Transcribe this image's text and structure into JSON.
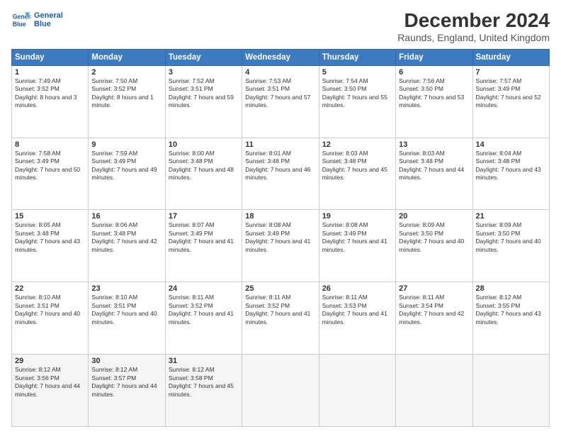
{
  "logo": {
    "line1": "General",
    "line2": "Blue"
  },
  "title": "December 2024",
  "subtitle": "Raunds, England, United Kingdom",
  "headers": [
    "Sunday",
    "Monday",
    "Tuesday",
    "Wednesday",
    "Thursday",
    "Friday",
    "Saturday"
  ],
  "weeks": [
    [
      {
        "day": "1",
        "sunrise": "7:49 AM",
        "sunset": "3:52 PM",
        "daylight": "8 hours and 3 minutes."
      },
      {
        "day": "2",
        "sunrise": "7:50 AM",
        "sunset": "3:52 PM",
        "daylight": "8 hours and 1 minute."
      },
      {
        "day": "3",
        "sunrise": "7:52 AM",
        "sunset": "3:51 PM",
        "daylight": "7 hours and 59 minutes."
      },
      {
        "day": "4",
        "sunrise": "7:53 AM",
        "sunset": "3:51 PM",
        "daylight": "7 hours and 57 minutes."
      },
      {
        "day": "5",
        "sunrise": "7:54 AM",
        "sunset": "3:50 PM",
        "daylight": "7 hours and 55 minutes."
      },
      {
        "day": "6",
        "sunrise": "7:56 AM",
        "sunset": "3:50 PM",
        "daylight": "7 hours and 53 minutes."
      },
      {
        "day": "7",
        "sunrise": "7:57 AM",
        "sunset": "3:49 PM",
        "daylight": "7 hours and 52 minutes."
      }
    ],
    [
      {
        "day": "8",
        "sunrise": "7:58 AM",
        "sunset": "3:49 PM",
        "daylight": "7 hours and 50 minutes."
      },
      {
        "day": "9",
        "sunrise": "7:59 AM",
        "sunset": "3:49 PM",
        "daylight": "7 hours and 49 minutes."
      },
      {
        "day": "10",
        "sunrise": "8:00 AM",
        "sunset": "3:48 PM",
        "daylight": "7 hours and 48 minutes."
      },
      {
        "day": "11",
        "sunrise": "8:01 AM",
        "sunset": "3:48 PM",
        "daylight": "7 hours and 46 minutes."
      },
      {
        "day": "12",
        "sunrise": "8:03 AM",
        "sunset": "3:48 PM",
        "daylight": "7 hours and 45 minutes."
      },
      {
        "day": "13",
        "sunrise": "8:03 AM",
        "sunset": "3:48 PM",
        "daylight": "7 hours and 44 minutes."
      },
      {
        "day": "14",
        "sunrise": "8:04 AM",
        "sunset": "3:48 PM",
        "daylight": "7 hours and 43 minutes."
      }
    ],
    [
      {
        "day": "15",
        "sunrise": "8:05 AM",
        "sunset": "3:48 PM",
        "daylight": "7 hours and 43 minutes."
      },
      {
        "day": "16",
        "sunrise": "8:06 AM",
        "sunset": "3:48 PM",
        "daylight": "7 hours and 42 minutes."
      },
      {
        "day": "17",
        "sunrise": "8:07 AM",
        "sunset": "3:49 PM",
        "daylight": "7 hours and 41 minutes."
      },
      {
        "day": "18",
        "sunrise": "8:08 AM",
        "sunset": "3:49 PM",
        "daylight": "7 hours and 41 minutes."
      },
      {
        "day": "19",
        "sunrise": "8:08 AM",
        "sunset": "3:49 PM",
        "daylight": "7 hours and 41 minutes."
      },
      {
        "day": "20",
        "sunrise": "8:09 AM",
        "sunset": "3:50 PM",
        "daylight": "7 hours and 40 minutes."
      },
      {
        "day": "21",
        "sunrise": "8:09 AM",
        "sunset": "3:50 PM",
        "daylight": "7 hours and 40 minutes."
      }
    ],
    [
      {
        "day": "22",
        "sunrise": "8:10 AM",
        "sunset": "3:51 PM",
        "daylight": "7 hours and 40 minutes."
      },
      {
        "day": "23",
        "sunrise": "8:10 AM",
        "sunset": "3:51 PM",
        "daylight": "7 hours and 40 minutes."
      },
      {
        "day": "24",
        "sunrise": "8:11 AM",
        "sunset": "3:52 PM",
        "daylight": "7 hours and 41 minutes."
      },
      {
        "day": "25",
        "sunrise": "8:11 AM",
        "sunset": "3:52 PM",
        "daylight": "7 hours and 41 minutes."
      },
      {
        "day": "26",
        "sunrise": "8:11 AM",
        "sunset": "3:53 PM",
        "daylight": "7 hours and 41 minutes."
      },
      {
        "day": "27",
        "sunrise": "8:11 AM",
        "sunset": "3:54 PM",
        "daylight": "7 hours and 42 minutes."
      },
      {
        "day": "28",
        "sunrise": "8:12 AM",
        "sunset": "3:55 PM",
        "daylight": "7 hours and 43 minutes."
      }
    ],
    [
      {
        "day": "29",
        "sunrise": "8:12 AM",
        "sunset": "3:56 PM",
        "daylight": "7 hours and 44 minutes."
      },
      {
        "day": "30",
        "sunrise": "8:12 AM",
        "sunset": "3:57 PM",
        "daylight": "7 hours and 44 minutes."
      },
      {
        "day": "31",
        "sunrise": "8:12 AM",
        "sunset": "3:58 PM",
        "daylight": "7 hours and 45 minutes."
      },
      null,
      null,
      null,
      null
    ]
  ]
}
